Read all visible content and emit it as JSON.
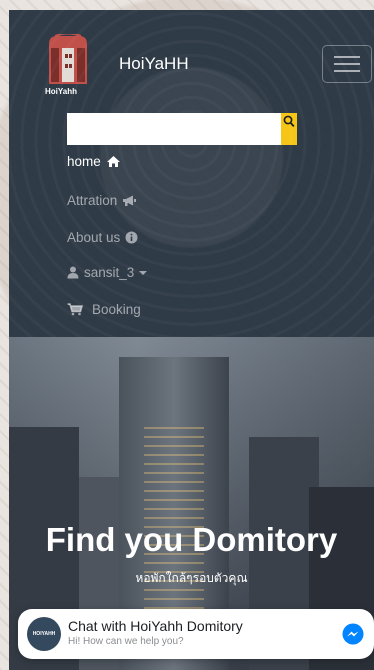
{
  "brand": {
    "name": "HoiYaHH",
    "logo_text": "HoiYahh"
  },
  "search": {
    "value": "",
    "placeholder": ""
  },
  "nav": {
    "home": "home",
    "attraction": "Attration",
    "about": "About us",
    "user": "sansit_3",
    "booking": "Booking"
  },
  "hero": {
    "title": "Find you Domitory",
    "subtitle": "หอพักใกล้ๆรอบตัวคุณ"
  },
  "chat": {
    "title": "Chat with HoiYahh Domitory",
    "subtitle": "Hi! How can we help you?",
    "avatar_text": "HOIYAHH"
  },
  "colors": {
    "navbar_bg": "#283442",
    "search_button": "#f5c518",
    "messenger": "#0084ff"
  },
  "icons": [
    "logo-building-icon",
    "menu-icon",
    "search-icon",
    "home-icon",
    "bullhorn-icon",
    "info-icon",
    "user-icon",
    "caret-down-icon",
    "cart-icon",
    "messenger-icon"
  ]
}
